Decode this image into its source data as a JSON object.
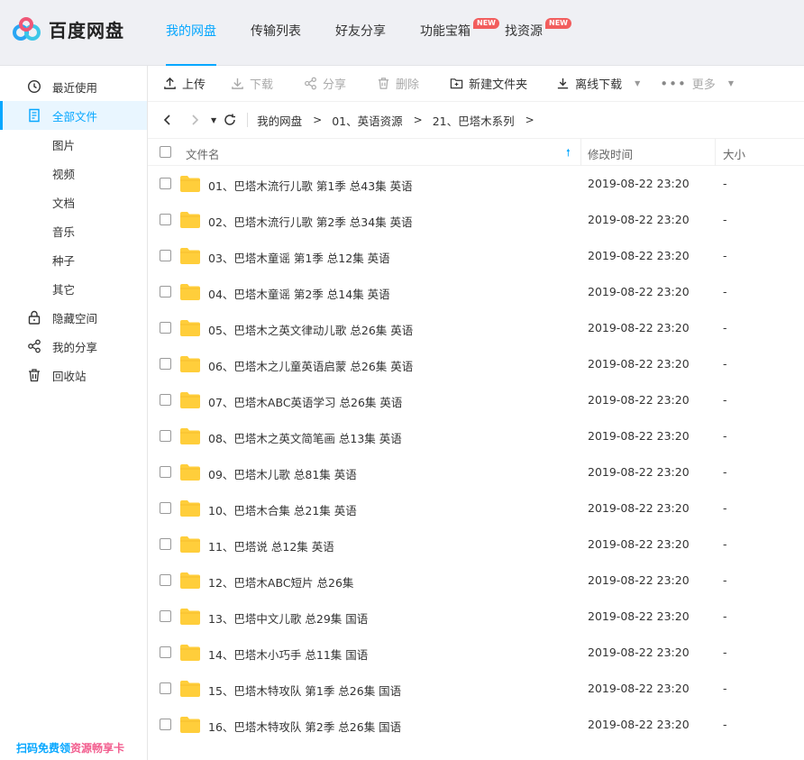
{
  "app": {
    "name": "百度网盘"
  },
  "nav": {
    "items": [
      {
        "label": "我的网盘",
        "active": true,
        "badge": ""
      },
      {
        "label": "传输列表",
        "active": false,
        "badge": ""
      },
      {
        "label": "好友分享",
        "active": false,
        "badge": ""
      },
      {
        "label": "功能宝箱",
        "active": false,
        "badge": "NEW"
      },
      {
        "label": "找资源",
        "active": false,
        "badge": "NEW"
      }
    ]
  },
  "sidebar": {
    "items": [
      {
        "label": "最近使用",
        "icon": "clock-icon",
        "active": false
      },
      {
        "label": "全部文件",
        "icon": "file-icon",
        "active": true
      },
      {
        "label": "图片",
        "icon": "",
        "active": false
      },
      {
        "label": "视频",
        "icon": "",
        "active": false
      },
      {
        "label": "文档",
        "icon": "",
        "active": false
      },
      {
        "label": "音乐",
        "icon": "",
        "active": false
      },
      {
        "label": "种子",
        "icon": "",
        "active": false
      },
      {
        "label": "其它",
        "icon": "",
        "active": false
      },
      {
        "label": "隐藏空间",
        "icon": "lock-icon",
        "active": false
      },
      {
        "label": "我的分享",
        "icon": "share-icon",
        "active": false
      },
      {
        "label": "回收站",
        "icon": "trash-icon",
        "active": false
      }
    ],
    "promo_part1": "扫码免费领",
    "promo_part2": "资源畅享卡"
  },
  "toolbar": {
    "upload": "上传",
    "download": "下载",
    "share": "分享",
    "delete": "删除",
    "new_folder": "新建文件夹",
    "offline_download": "离线下载",
    "more": "更多"
  },
  "breadcrumb": {
    "items": [
      "我的网盘",
      "01、英语资源",
      "21、巴塔木系列"
    ],
    "separator": ">"
  },
  "table": {
    "headers": {
      "name": "文件名",
      "modified": "修改时间",
      "size": "大小"
    },
    "rows": [
      {
        "name": "01、巴塔木流行儿歌 第1季 总43集 英语",
        "modified": "2019-08-22 23:20",
        "size": "-"
      },
      {
        "name": "02、巴塔木流行儿歌 第2季 总34集 英语",
        "modified": "2019-08-22 23:20",
        "size": "-"
      },
      {
        "name": "03、巴塔木童谣 第1季 总12集 英语",
        "modified": "2019-08-22 23:20",
        "size": "-"
      },
      {
        "name": "04、巴塔木童谣 第2季 总14集 英语",
        "modified": "2019-08-22 23:20",
        "size": "-"
      },
      {
        "name": "05、巴塔木之英文律动儿歌 总26集 英语",
        "modified": "2019-08-22 23:20",
        "size": "-"
      },
      {
        "name": "06、巴塔木之儿童英语启蒙 总26集 英语",
        "modified": "2019-08-22 23:20",
        "size": "-"
      },
      {
        "name": "07、巴塔木ABC英语学习 总26集 英语",
        "modified": "2019-08-22 23:20",
        "size": "-"
      },
      {
        "name": "08、巴塔木之英文简笔画 总13集 英语",
        "modified": "2019-08-22 23:20",
        "size": "-"
      },
      {
        "name": "09、巴塔木儿歌 总81集 英语",
        "modified": "2019-08-22 23:20",
        "size": "-"
      },
      {
        "name": "10、巴塔木合集 总21集 英语",
        "modified": "2019-08-22 23:20",
        "size": "-"
      },
      {
        "name": "11、巴塔说 总12集 英语",
        "modified": "2019-08-22 23:20",
        "size": "-"
      },
      {
        "name": "12、巴塔木ABC短片 总26集",
        "modified": "2019-08-22 23:20",
        "size": "-"
      },
      {
        "name": "13、巴塔中文儿歌 总29集 国语",
        "modified": "2019-08-22 23:20",
        "size": "-"
      },
      {
        "name": "14、巴塔木小巧手 总11集 国语",
        "modified": "2019-08-22 23:20",
        "size": "-"
      },
      {
        "name": "15、巴塔木特攻队 第1季 总26集 国语",
        "modified": "2019-08-22 23:20",
        "size": "-"
      },
      {
        "name": "16、巴塔木特攻队 第2季 总26集 国语",
        "modified": "2019-08-22 23:20",
        "size": "-"
      }
    ]
  },
  "colors": {
    "accent": "#06a7ff",
    "folder": "#ffce3b",
    "badge": "#f25d5d",
    "promo_pink": "#f25d8e"
  }
}
